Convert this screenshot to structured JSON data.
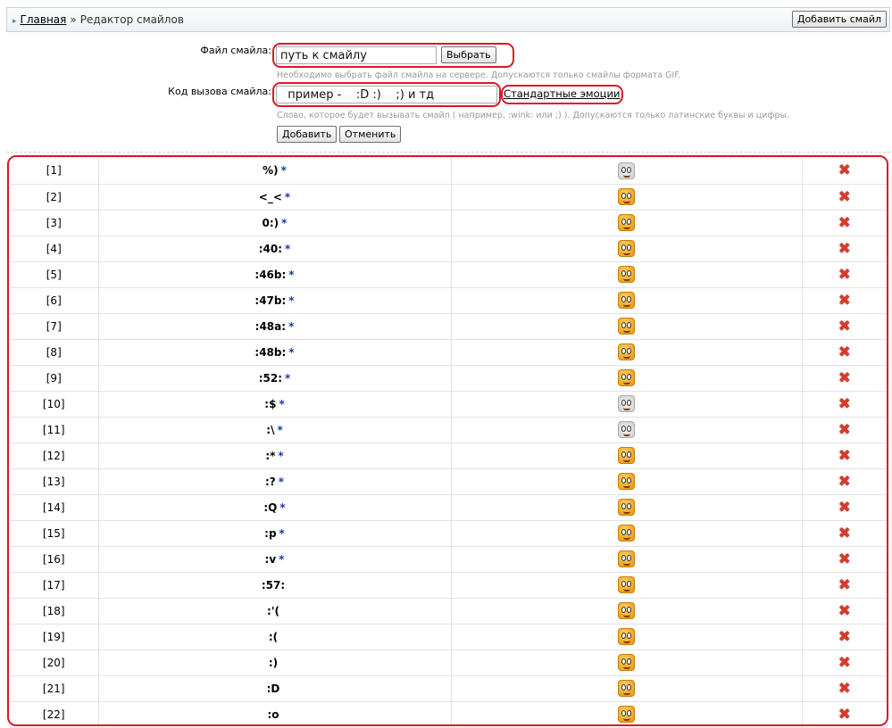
{
  "breadcrumb": {
    "home": "Главная",
    "separator": "»",
    "current": "Редактор смайлов"
  },
  "toolbar": {
    "add_smiley": "Добавить смайл"
  },
  "form": {
    "file_label": "Файл смайла:",
    "file_value": "путь к смайлу",
    "browse_button": "Выбрать",
    "file_hint": "Необходимо выбрать файл смайла на сервере. Допускаются только смайлы формата GIF.",
    "code_label": "Код вызова смайла:",
    "code_value": "  пример -    :D :)    ;) и тд",
    "standard_link": "Стандартные эмоции",
    "code_hint": "Слово, которое будет вызывать смайл ( например, :wink: или ;) ). Допускаются только латинские буквы и цифры.",
    "add_button": "Добавить",
    "cancel_button": "Отменить"
  },
  "accent_color": "#d9192a",
  "rows": [
    {
      "num": "[1]",
      "code": "%)",
      "star": "*",
      "icon": "thumbs-up-icon"
    },
    {
      "num": "[2]",
      "code": "<_<",
      "star": "*",
      "icon": "smiley-annoyed-icon"
    },
    {
      "num": "[3]",
      "code": "0:)",
      "star": "*",
      "icon": "smiley-angel-icon"
    },
    {
      "num": "[4]",
      "code": ":40:",
      "star": "*",
      "icon": "dollar-icon"
    },
    {
      "num": "[5]",
      "code": ":46b:",
      "star": "*",
      "icon": "smiley-icon"
    },
    {
      "num": "[6]",
      "code": ":47b:",
      "star": "*",
      "icon": "smiley-icon"
    },
    {
      "num": "[7]",
      "code": ":48a:",
      "star": "*",
      "icon": "smiley-icon"
    },
    {
      "num": "[8]",
      "code": ":48b:",
      "star": "*",
      "icon": "smiley-icon"
    },
    {
      "num": "[9]",
      "code": ":52:",
      "star": "*",
      "icon": "smiley-wink-icon"
    },
    {
      "num": "[10]",
      "code": ":$",
      "star": "*",
      "icon": "beer-icon"
    },
    {
      "num": "[11]",
      "code": ":\\",
      "star": "*",
      "icon": "thumbs-down-icon"
    },
    {
      "num": "[12]",
      "code": ":*",
      "star": "*",
      "icon": "smiley-kiss-icon"
    },
    {
      "num": "[13]",
      "code": ":?",
      "star": "*",
      "icon": "smiley-confused-icon"
    },
    {
      "num": "[14]",
      "code": ":Q",
      "star": "*",
      "icon": "smiley-icon"
    },
    {
      "num": "[15]",
      "code": ":p",
      "star": "*",
      "icon": "smiley-tongue-icon"
    },
    {
      "num": "[16]",
      "code": ":v",
      "star": "*",
      "icon": "smiley-icon"
    },
    {
      "num": "[17]",
      "code": ":57:",
      "star": "",
      "icon": "smiley-icon"
    },
    {
      "num": "[18]",
      "code": ":'(",
      "star": "",
      "icon": "smiley-cry-icon"
    },
    {
      "num": "[19]",
      "code": ":(",
      "star": "",
      "icon": "smiley-sad-icon"
    },
    {
      "num": "[20]",
      "code": ":)",
      "star": "",
      "icon": "smiley-happy-icon"
    },
    {
      "num": "[21]",
      "code": ":D",
      "star": "",
      "icon": "smiley-grin-icon"
    },
    {
      "num": "[22]",
      "code": ":o",
      "star": "",
      "icon": "smiley-shout-icon"
    }
  ]
}
